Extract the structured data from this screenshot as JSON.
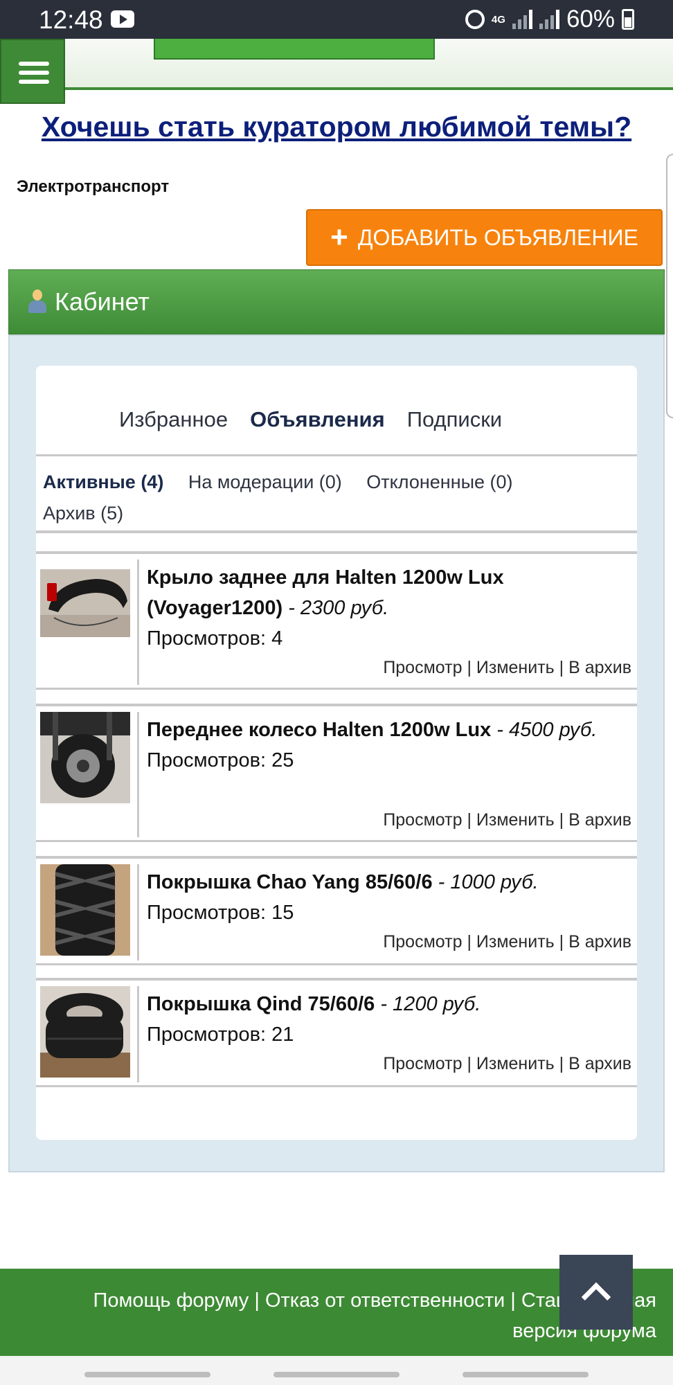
{
  "status_bar": {
    "time": "12:48",
    "network": "4G",
    "battery": "60%"
  },
  "header": {
    "promo_link": "Хочешь стать куратором любимой темы?"
  },
  "section": {
    "label": "Электротранспорт",
    "add_button": "ДОБАВИТЬ ОБЪЯВЛЕНИЕ"
  },
  "cabinet": {
    "title": "Кабинет",
    "tabs": [
      {
        "label": "Избранное"
      },
      {
        "label": "Объявления"
      },
      {
        "label": "Подписки"
      }
    ],
    "subtabs": [
      {
        "label": "Активные (4)"
      },
      {
        "label": "На модерации (0)"
      },
      {
        "label": "Отклоненные (0)"
      },
      {
        "label": "Архив (5)"
      }
    ],
    "listings": [
      {
        "title": "Крыло заднее для Halten 1200w Lux (Voyager1200)",
        "price": "- 2300 руб.",
        "views": "Просмотров: 4"
      },
      {
        "title": "Переднее колесо Halten 1200w Lux",
        "price": "- 4500 руб.",
        "views": "Просмотров: 25"
      },
      {
        "title": "Покрышка Chao Yang 85/60/6",
        "price": "- 1000 руб.",
        "views": "Просмотров: 15"
      },
      {
        "title": "Покрышка Qind 75/60/6",
        "price": "- 1200 руб.",
        "views": "Просмотров: 21"
      }
    ],
    "actions": {
      "view": "Просмотр",
      "edit": "Изменить",
      "archive": "В архив",
      "separator": "|"
    }
  },
  "footer": {
    "help": "Помощь форуму",
    "disclaimer": "Отказ от ответственности",
    "classic": "Стационарная версия форума",
    "separator": "|"
  },
  "colors": {
    "green": "#3f8a36",
    "orange": "#f7830e",
    "link_blue": "#0c1f7a"
  }
}
